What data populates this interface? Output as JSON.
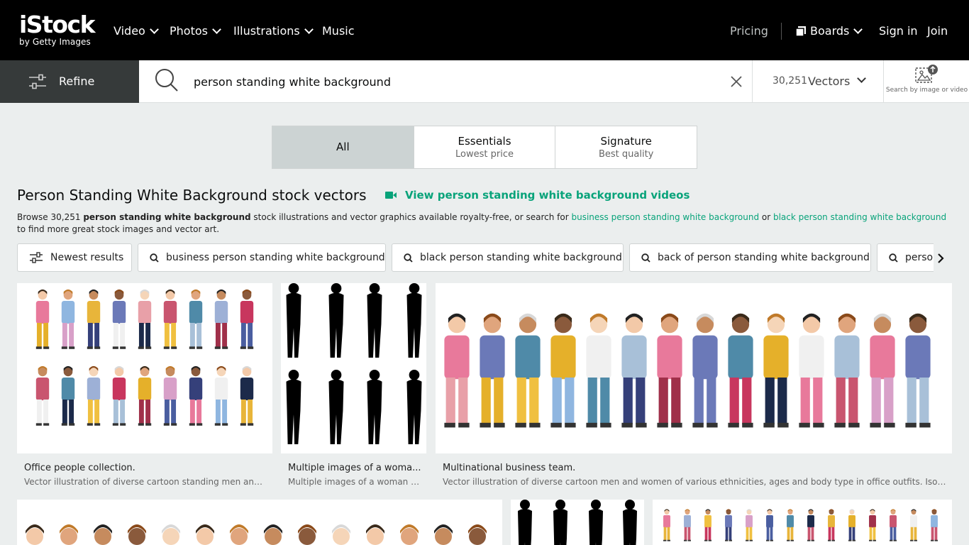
{
  "brand": {
    "name": "iStock",
    "sub": "by Getty Images"
  },
  "nav": {
    "video": "Video",
    "photos": "Photos",
    "illustrations": "Illustrations",
    "music": "Music",
    "pricing": "Pricing",
    "boards": "Boards",
    "sign_in": "Sign in",
    "join": "Join"
  },
  "search": {
    "refine_label": "Refine",
    "query": "person standing white background",
    "result_count": "30,251",
    "media_type": "Vectors",
    "search_by_image": "Search by image or video"
  },
  "tabs": [
    {
      "title": "All",
      "subtitle": ""
    },
    {
      "title": "Essentials",
      "subtitle": "Lowest price"
    },
    {
      "title": "Signature",
      "subtitle": "Best quality"
    }
  ],
  "heading": {
    "title": "Person Standing White Background stock vectors",
    "video_link": "View person standing white background videos"
  },
  "description": {
    "prefix": "Browse 30,251 ",
    "bold": "person standing white background",
    "middle": " stock illustrations and vector graphics available royalty-free, or search for ",
    "link1": "business person standing white background",
    "or": " or ",
    "link2": "black person standing white background",
    "suffix": " to find more great stock images and vector art."
  },
  "chips": [
    "Newest results",
    "business person standing white background",
    "black person standing white background",
    "back of person standing white background",
    "person"
  ],
  "results": [
    {
      "title": "Office people collection.",
      "description": "Vector illustration of diverse cartoon standing men and w..."
    },
    {
      "title": "Multiple images of a woma...",
      "description": "Multiple images of a woman wi..."
    },
    {
      "title": "Multinational business team.",
      "description": "Vector illustration of diverse cartoon men and women of various ethnicities, ages and body type in office outfits. Isolated o..."
    }
  ],
  "colors": {
    "accent": "#08a37a",
    "nav_bg": "#000000",
    "refine_bg": "#363a3a",
    "page_bg": "#ebeeee"
  }
}
